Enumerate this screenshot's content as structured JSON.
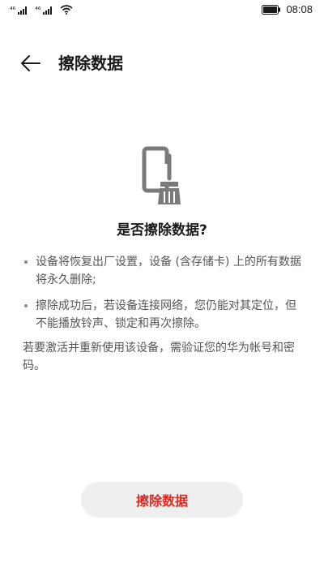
{
  "status_bar": {
    "sim1_label": "⁴⁶",
    "sim2_label": "⁴⁶",
    "time": "08:08",
    "icons": [
      "signal-icon",
      "signal-icon",
      "wifi-icon",
      "battery-icon"
    ]
  },
  "header": {
    "back_icon": "arrow-left-icon",
    "title": "擦除数据"
  },
  "hero": {
    "icon": "phone-broom-icon",
    "color": "#7a7a7a"
  },
  "content": {
    "question": "是否擦除数据?",
    "bullets": [
      "设备将恢复出厂设置，设备 (含存储卡) 上的所有数据将永久删除;",
      "擦除成功后，若设备连接网络，您仍能对其定位，但不能播放铃声、锁定和再次擦除。"
    ],
    "note": "若要激活并重新使用该设备，需验证您的华为帐号和密码。"
  },
  "action": {
    "button_label": "擦除数据",
    "button_text_color": "#e0281e",
    "button_bg_color": "#efefef"
  }
}
